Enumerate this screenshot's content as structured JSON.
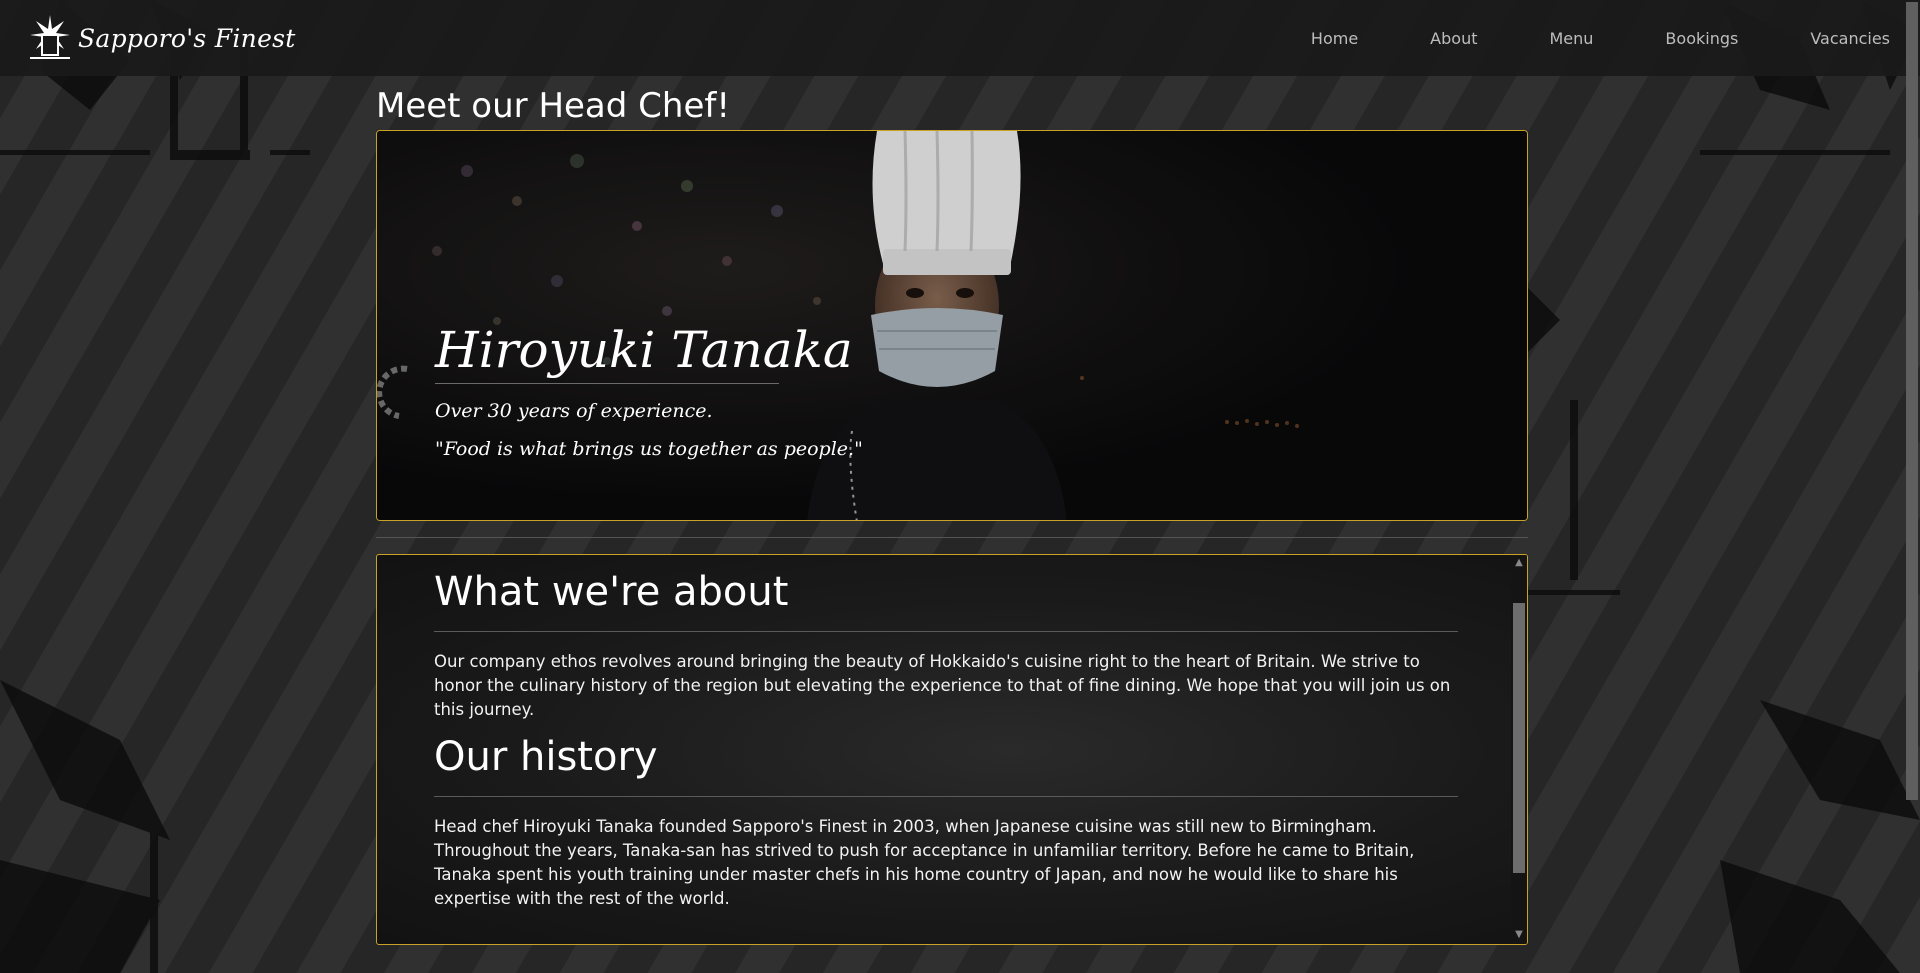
{
  "brand": {
    "name": "Sapporo's Finest",
    "logo_icon": "sapporo-star-glass-icon"
  },
  "nav": {
    "items": [
      {
        "label": "Home"
      },
      {
        "label": "About"
      },
      {
        "label": "Menu"
      },
      {
        "label": "Bookings"
      },
      {
        "label": "Vacancies"
      }
    ]
  },
  "page": {
    "heading": "Meet our Head Chef!"
  },
  "chef": {
    "name": "Hiroyuki Tanaka",
    "experience": "Over 30 years of experience.",
    "quote": "\"Food is what brings us together as people.\""
  },
  "about": {
    "sections": [
      {
        "title": "What we're about",
        "body": "Our company ethos revolves around bringing the beauty of Hokkaido's cuisine right to the heart of Britain. We strive to honor the culinary history of the region but elevating the experience to that of fine dining. We hope that you will join us on this journey."
      },
      {
        "title": "Our history",
        "body": "Head chef Hiroyuki Tanaka founded Sapporo's Finest in 2003, when Japanese cuisine was still new to Birmingham. Throughout the years, Tanaka-san has strived to push for acceptance in unfamiliar territory. Before he came to Britain, Tanaka spent his youth training under master chefs in his home country of Japan, and now he would like to share his expertise with the rest of the world."
      }
    ]
  },
  "colors": {
    "accent_border": "#c9a227",
    "nav_bg": "#1a1a1a",
    "nav_text": "#bdbdbd"
  }
}
